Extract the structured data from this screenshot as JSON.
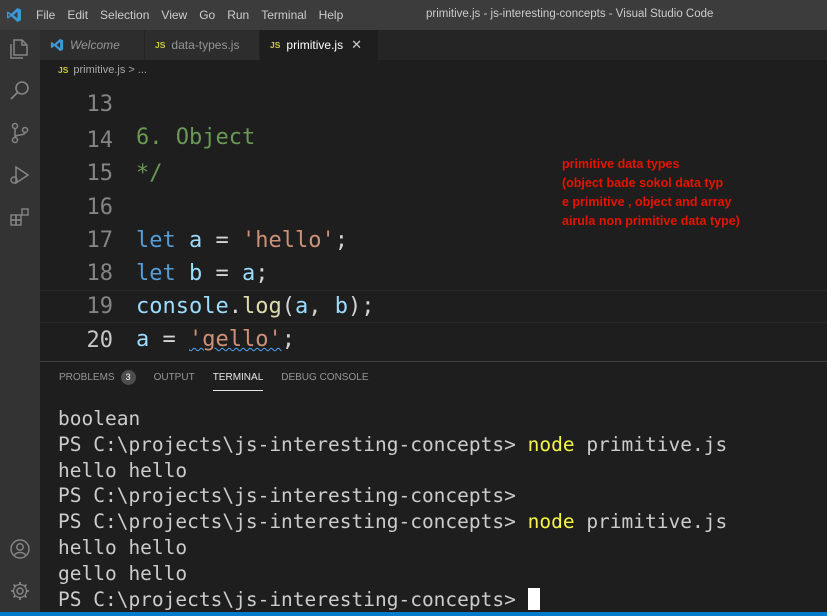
{
  "titlebar": {
    "menu": [
      "File",
      "Edit",
      "Selection",
      "View",
      "Go",
      "Run",
      "Terminal",
      "Help"
    ],
    "title": "primitive.js - js-interesting-concepts - Visual Studio Code"
  },
  "tabs": [
    {
      "label": "Welcome",
      "icon": "vscode-icon",
      "active": false
    },
    {
      "label": "data-types.js",
      "icon": "js-icon",
      "active": false
    },
    {
      "label": "primitive.js",
      "icon": "js-icon",
      "active": true,
      "close": "✕"
    }
  ],
  "breadcrumb": {
    "file": "primitive.js",
    "sep": ">",
    "rest": "..."
  },
  "editor": {
    "lines": [
      {
        "num": "13",
        "code": "6. Object"
      },
      {
        "num": "14",
        "code": "*/"
      },
      {
        "num": "15",
        "code": ""
      },
      {
        "num": "16",
        "code": "let a = 'hello';"
      },
      {
        "num": "17",
        "code": "let b = a;"
      },
      {
        "num": "18",
        "code": "console.log(a, b);"
      },
      {
        "num": "19",
        "code": "a = 'gello';"
      },
      {
        "num": "20",
        "code": "console.log(a, b);"
      }
    ]
  },
  "note": [
    "primitive data types",
    "(object bade sokol data typ",
    "e primitive , object and array",
    "airula non primitive data type)"
  ],
  "panel": {
    "tabs": [
      "PROBLEMS",
      "OUTPUT",
      "TERMINAL",
      "DEBUG CONSOLE"
    ],
    "problems_count": "3",
    "active_tab": "TERMINAL"
  },
  "terminal": {
    "lines": [
      {
        "text": "boolean"
      },
      {
        "prompt": "PS C:\\projects\\js-interesting-concepts> ",
        "cmd": "node",
        "args": " primitive.js"
      },
      {
        "text": "hello hello"
      },
      {
        "prompt": "PS C:\\projects\\js-interesting-concepts>"
      },
      {
        "prompt": "PS C:\\projects\\js-interesting-concepts> ",
        "cmd": "node",
        "args": " primitive.js"
      },
      {
        "text": "hello hello"
      },
      {
        "text": "gello hello"
      },
      {
        "prompt": "PS C:\\projects\\js-interesting-concepts> "
      }
    ]
  },
  "colors": {
    "accent": "#007acc",
    "note": "#e51400",
    "js_icon": "#cbcb41"
  }
}
